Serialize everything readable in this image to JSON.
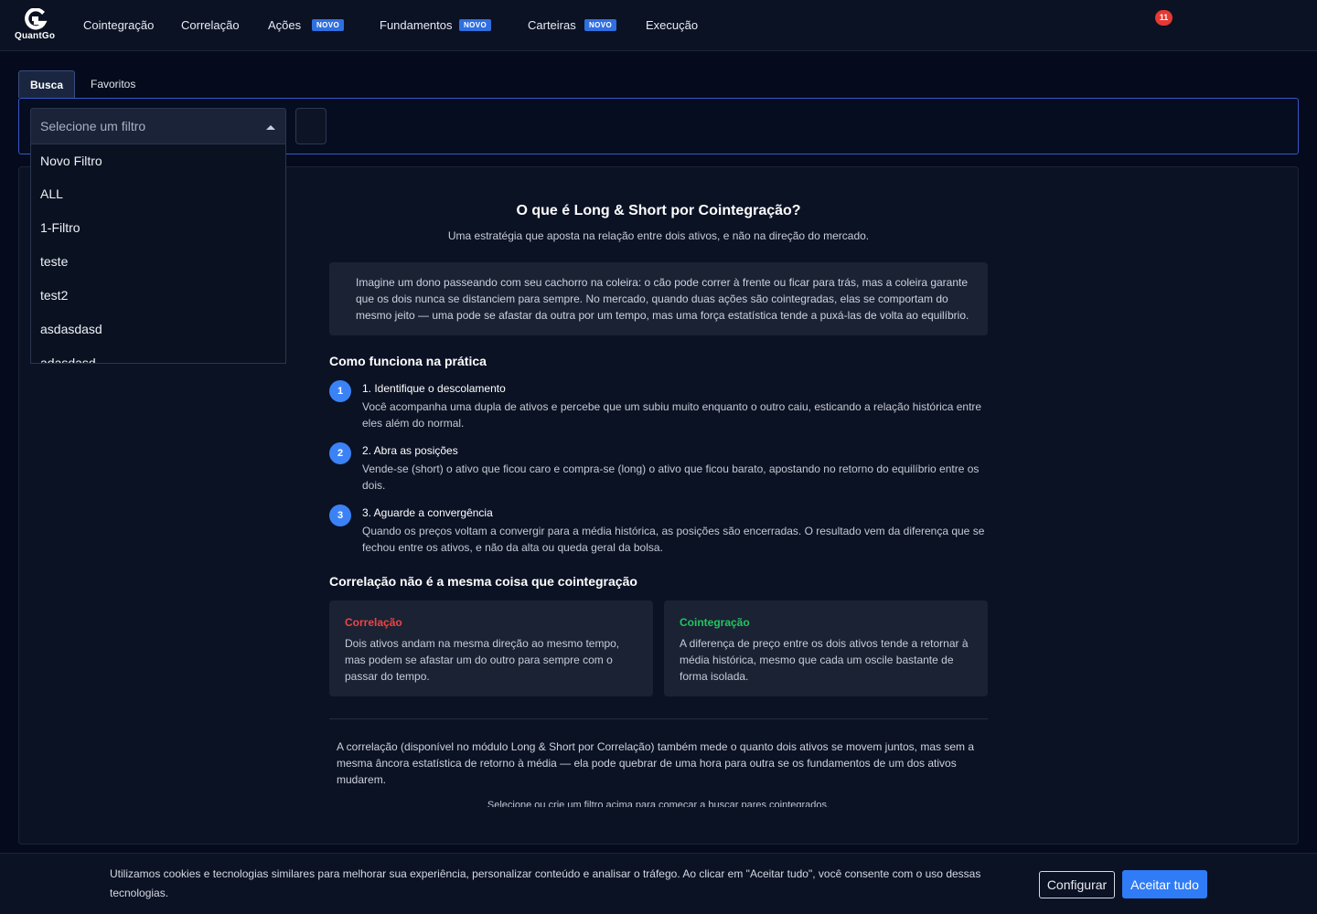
{
  "app": {
    "logo_text": "QuantGo"
  },
  "nav": {
    "items": [
      {
        "label": "Cointegração",
        "badge": ""
      },
      {
        "label": "Correlação",
        "badge": ""
      },
      {
        "label": "Ações",
        "badge": "NOVO"
      },
      {
        "label": "Fundamentos",
        "badge": "NOVO"
      },
      {
        "label": "Carteiras",
        "badge": "NOVO"
      },
      {
        "label": "Execução",
        "badge": ""
      }
    ],
    "notification_count": "11"
  },
  "tabs": [
    {
      "label": "Busca",
      "active": true
    },
    {
      "label": "Favoritos",
      "active": false
    }
  ],
  "filter": {
    "placeholder": "Selecione um filtro",
    "options": [
      "Novo Filtro",
      "ALL",
      "1-Filtro",
      "teste",
      "test2",
      "asdasdasd",
      "adasdasd"
    ]
  },
  "content": {
    "title": "O que é Long & Short por Cointegração?",
    "subtitle": "Uma estratégia que aposta na relação entre dois ativos, e não na direção do mercado.",
    "analogy": "Imagine um dono passeando com seu cachorro na coleira: o cão pode correr à frente ou ficar para trás, mas a coleira garante que os dois nunca se distanciem para sempre. No mercado, quando duas ações são cointegradas, elas se comportam do mesmo jeito — uma pode se afastar da outra por um tempo, mas uma força estatística tende a puxá-las de volta ao equilíbrio.",
    "how_title": "Como funciona na prática",
    "steps": [
      {
        "num": "1",
        "title": "1. Identifique o descolamento",
        "desc": "Você acompanha uma dupla de ativos e percebe que um subiu muito enquanto o outro caiu, esticando a relação histórica entre eles além do normal."
      },
      {
        "num": "2",
        "title": "2. Abra as posições",
        "desc": "Vende-se (short) o ativo que ficou caro e compra-se (long) o ativo que ficou barato, apostando no retorno do equilíbrio entre os dois."
      },
      {
        "num": "3",
        "title": "3. Aguarde a convergência",
        "desc": "Quando os preços voltam a convergir para a média histórica, as posições são encerradas. O resultado vem da diferença que se fechou entre os ativos, e não da alta ou queda geral da bolsa."
      }
    ],
    "compare_title": "Correlação não é a mesma coisa que cointegração",
    "cards": [
      {
        "title": "Correlação",
        "color": "#ef4444",
        "text": "Dois ativos andam na mesma direção ao mesmo tempo, mas podem se afastar um do outro para sempre com o passar do tempo."
      },
      {
        "title": "Cointegração",
        "color": "#22c55e",
        "text": "A diferença de preço entre os dois ativos tende a retornar à média histórica, mesmo que cada um oscile bastante de forma isolada."
      }
    ],
    "note": "A correlação (disponível no módulo Long & Short por Correlação) também mede o quanto dois ativos se movem juntos, mas sem a mesma âncora estatística de retorno à média — ela pode quebrar de uma hora para outra se os fundamentos de um dos ativos mudarem.",
    "hint": "Selecione ou crie um filtro acima para começar a buscar pares cointegrados."
  },
  "cookie": {
    "text": "Utilizamos cookies e tecnologias similares para melhorar sua experiência, personalizar conteúdo e analisar o tráfego. Ao clicar em \"Aceitar tudo\", você consente com o uso dessas tecnologias.",
    "configure_label": "Configurar",
    "accept_label": "Aceitar tudo"
  },
  "colors": {
    "accent": "#2f7cf6",
    "badge": "#2f6fe0",
    "notification": "#e53935",
    "step": "#3b82f6"
  }
}
